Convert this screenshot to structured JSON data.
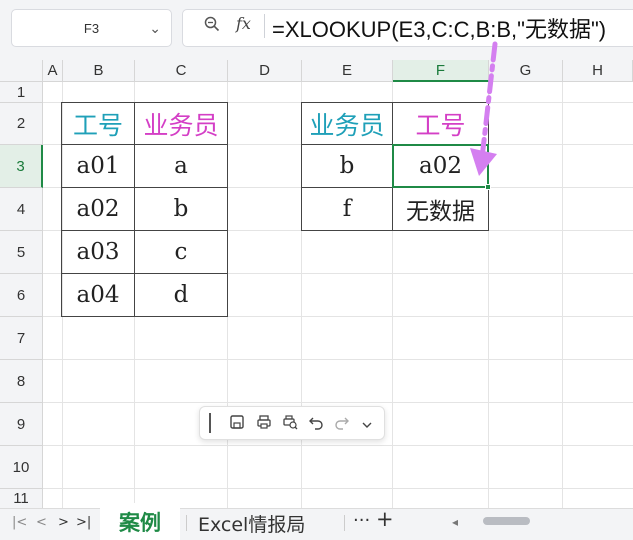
{
  "formula_bar": {
    "name_box": "F3",
    "zoom_icon": "zoom-icon",
    "fx_label": "fx",
    "formula": "=XLOOKUP(E3,C:C,B:B,\"无数据\")"
  },
  "columns": [
    "A",
    "B",
    "C",
    "D",
    "E",
    "F",
    "G",
    "H"
  ],
  "rows": [
    "1",
    "2",
    "3",
    "4",
    "5",
    "6",
    "7",
    "8",
    "9",
    "10",
    "11"
  ],
  "active_cell": {
    "column": "F",
    "row": "3"
  },
  "left_table": {
    "headers": [
      "工号",
      "业务员"
    ],
    "rows": [
      [
        "a01",
        "a"
      ],
      [
        "a02",
        "b"
      ],
      [
        "a03",
        "c"
      ],
      [
        "a04",
        "d"
      ]
    ]
  },
  "right_table": {
    "headers": [
      "业务员",
      "工号"
    ],
    "rows": [
      [
        "b",
        "a02"
      ],
      [
        "f",
        "无数据"
      ]
    ]
  },
  "colors": {
    "header_cyan": "#1fa0b8",
    "header_pink": "#d43fc6",
    "accent_green": "#1f8a46",
    "annotation_arrow": "#d47ff0"
  },
  "floating_toolbar": {
    "items": [
      "save-icon",
      "print-icon",
      "print-preview-icon",
      "undo-icon",
      "redo-icon",
      "chevron-down-icon"
    ]
  },
  "sheet_tabs": {
    "nav": [
      "|<",
      "<",
      ">",
      ">|"
    ],
    "tabs": [
      "案例",
      "Excel情报局"
    ],
    "active": "案例",
    "more": "···",
    "add": "+"
  }
}
